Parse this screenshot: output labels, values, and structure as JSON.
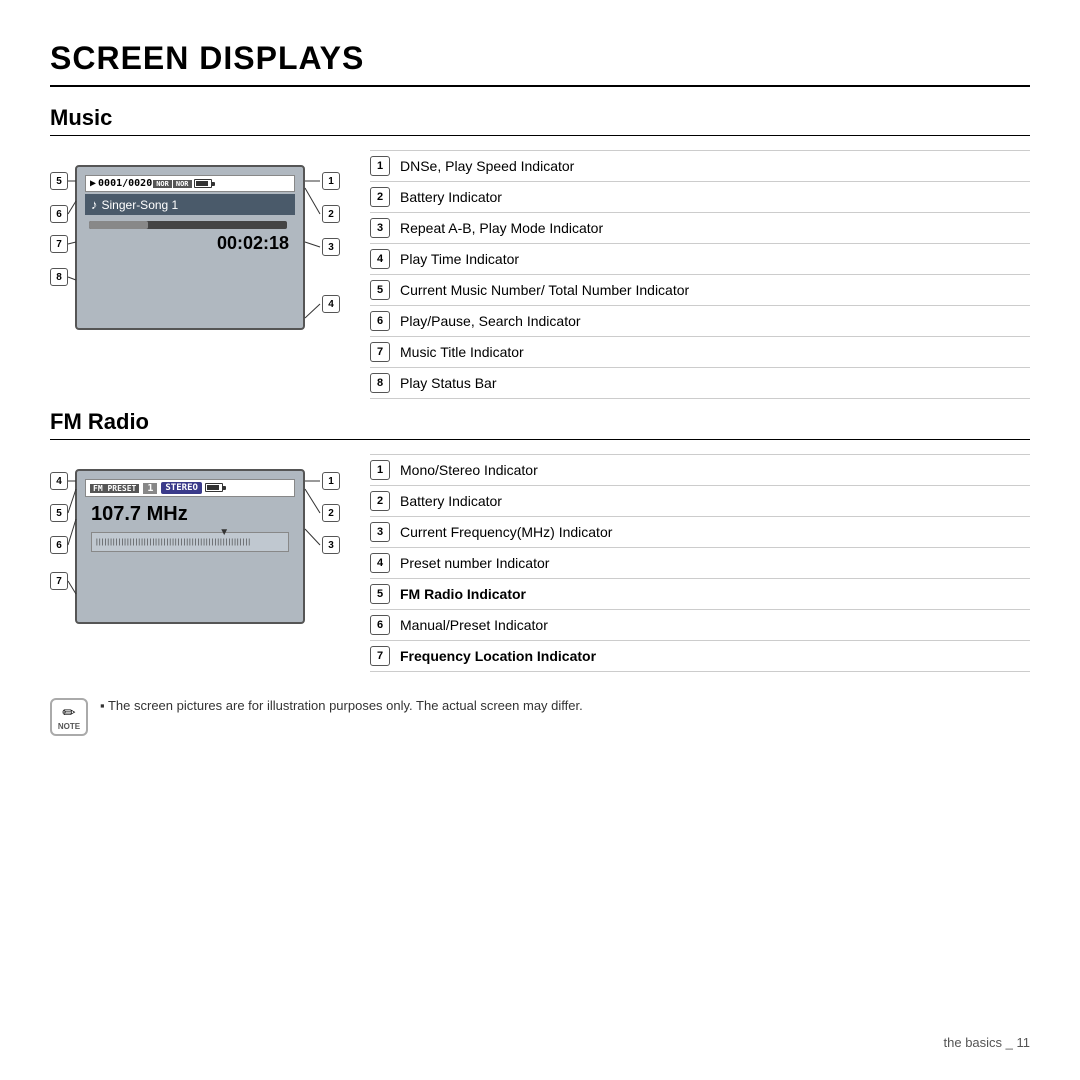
{
  "page": {
    "title": "SCREEN DISPLAYS",
    "footer": "the basics _ 11"
  },
  "music_section": {
    "title": "Music",
    "screen": {
      "track_info": "0001/0020",
      "song_title": "Singer-Song 1",
      "time": "00:02:18"
    },
    "indicators": [
      {
        "num": "1",
        "text": "DNSe, Play Speed Indicator",
        "bold": false
      },
      {
        "num": "2",
        "text": "Battery Indicator",
        "bold": false
      },
      {
        "num": "3",
        "text": "Repeat A-B, Play Mode Indicator",
        "bold": false
      },
      {
        "num": "4",
        "text": "Play Time Indicator",
        "bold": false
      },
      {
        "num": "5",
        "text": "Current Music Number/ Total Number Indicator",
        "bold": false
      },
      {
        "num": "6",
        "text": "Play/Pause, Search Indicator",
        "bold": false
      },
      {
        "num": "7",
        "text": "Music Title Indicator",
        "bold": false
      },
      {
        "num": "8",
        "text": "Play Status Bar",
        "bold": false
      }
    ]
  },
  "radio_section": {
    "title": "FM Radio",
    "screen": {
      "preset_label": "FM PRESET",
      "preset_num": "1",
      "frequency": "107.7 MHz"
    },
    "indicators": [
      {
        "num": "1",
        "text": "Mono/Stereo Indicator",
        "bold": false
      },
      {
        "num": "2",
        "text": "Battery Indicator",
        "bold": false
      },
      {
        "num": "3",
        "text": "Current Frequency(MHz) Indicator",
        "bold": false
      },
      {
        "num": "4",
        "text": "Preset number Indicator",
        "bold": false
      },
      {
        "num": "5",
        "text": "FM Radio Indicator",
        "bold": true
      },
      {
        "num": "6",
        "text": "Manual/Preset Indicator",
        "bold": false
      },
      {
        "num": "7",
        "text": "Frequency Location Indicator",
        "bold": true
      }
    ]
  },
  "note": {
    "icon_label": "NOTE",
    "text": "▪ The screen pictures are for illustration purposes only. The actual screen may differ."
  }
}
